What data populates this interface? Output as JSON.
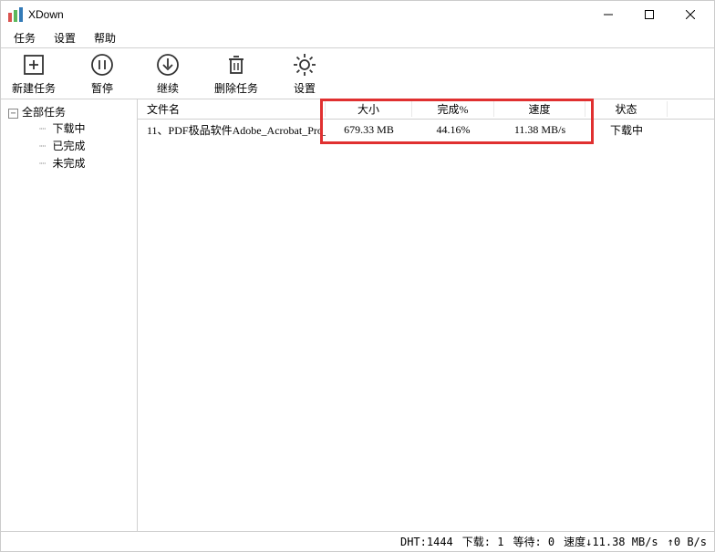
{
  "window": {
    "title": "XDown"
  },
  "menu": {
    "items": [
      "任务",
      "设置",
      "帮助"
    ]
  },
  "toolbar": {
    "new_task": "新建任务",
    "pause": "暂停",
    "resume": "继续",
    "delete": "删除任务",
    "settings": "设置"
  },
  "sidebar": {
    "root_label": "全部任务",
    "children": [
      "下载中",
      "已完成",
      "未完成"
    ]
  },
  "table": {
    "headers": {
      "name": "文件名",
      "size": "大小",
      "percent": "完成%",
      "speed": "速度",
      "state": "状态"
    },
    "rows": [
      {
        "name": "11、PDF极品软件Adobe_Acrobat_Pro_...",
        "size": "679.33 MB",
        "percent": "44.16%",
        "speed": "11.38 MB/s",
        "state": "下载中"
      }
    ]
  },
  "statusbar": {
    "dht": "DHT:1444",
    "download_label": "下载: 1",
    "wait_label": "等待: 0",
    "speed_label": "速度",
    "down_speed": "11.38 MB/s",
    "up_speed": "0 B/s"
  }
}
